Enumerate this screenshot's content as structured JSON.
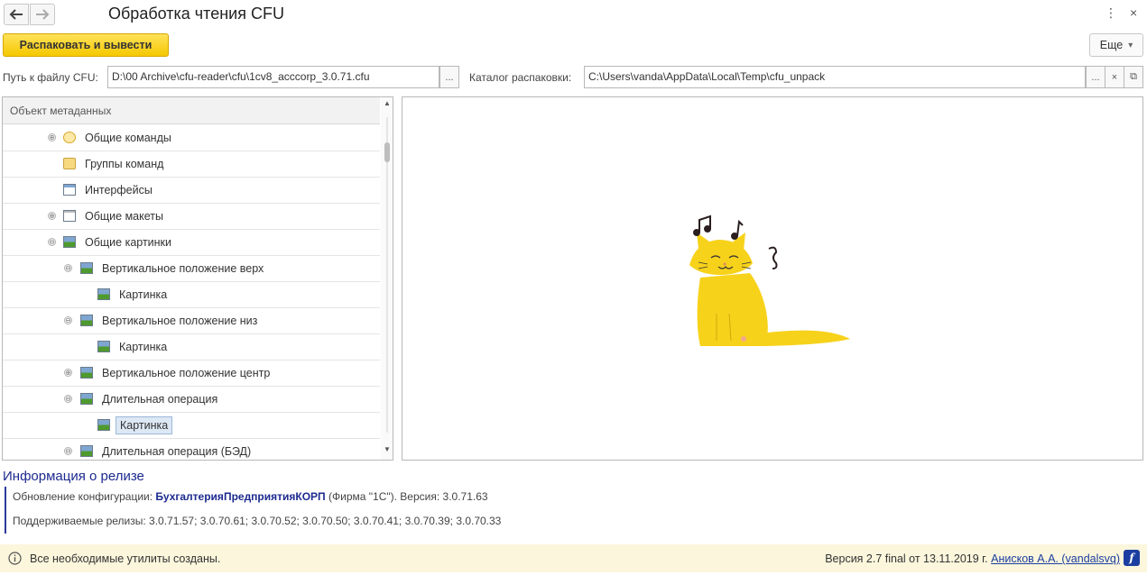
{
  "window": {
    "title": "Обработка чтения CFU",
    "back_icon": "arrow-left-icon",
    "forward_icon": "arrow-right-icon",
    "menu_glyph": "⋮",
    "close_glyph": "×"
  },
  "toolbar": {
    "unpack_label": "Распаковать и вывести",
    "more_label": "Еще",
    "more_arrow": "▾"
  },
  "fields": {
    "cfu_path_label": "Путь к файлу CFU:",
    "cfu_path_value": "D:\\00 Archive\\cfu-reader\\cfu\\1cv8_acccorp_3.0.71.cfu",
    "unpack_dir_label": "Каталог распаковки:",
    "unpack_dir_value": "C:\\Users\\vanda\\AppData\\Local\\Temp\\cfu_unpack",
    "browse_glyph": "...",
    "clear_glyph": "×",
    "open_glyph": "⧉"
  },
  "tree": {
    "header": "Объект метаданных",
    "items": [
      {
        "label": "Общие команды",
        "expander": "⊕",
        "icon": "command-icon"
      },
      {
        "label": "Группы команд",
        "expander": "",
        "icon": "folder-icon"
      },
      {
        "label": "Интерфейсы",
        "expander": "",
        "icon": "interface-icon"
      },
      {
        "label": "Общие макеты",
        "expander": "⊕",
        "icon": "layout-icon"
      },
      {
        "label": "Общие картинки",
        "expander": "⊖",
        "icon": "picture-icon"
      },
      {
        "label": "Вертикальное положение верх",
        "expander": "⊖",
        "icon": "picture-icon"
      },
      {
        "label": "Картинка",
        "expander": "",
        "icon": "picture-icon"
      },
      {
        "label": "Вертикальное положение низ",
        "expander": "⊖",
        "icon": "picture-icon"
      },
      {
        "label": "Картинка",
        "expander": "",
        "icon": "picture-icon"
      },
      {
        "label": "Вертикальное положение центр",
        "expander": "⊕",
        "icon": "picture-icon"
      },
      {
        "label": "Длительная операция",
        "expander": "⊖",
        "icon": "picture-icon"
      },
      {
        "label": "Картинка",
        "expander": "",
        "icon": "picture-icon",
        "selected": true
      },
      {
        "label": "Длительная операция (БЭД)",
        "expander": "⊖",
        "icon": "picture-icon"
      }
    ]
  },
  "preview": {
    "image": "singing-yellow-cat-icon",
    "colors": {
      "cat": "#f7d21b",
      "notes": "#2b1e1e"
    }
  },
  "release": {
    "title": "Информация о релизе",
    "update_prefix": "Обновление конфигурации: ",
    "config_name": "БухгалтерияПредприятияКОРП",
    "update_suffix": " (Фирма \"1С\"). Версия: 3.0.71.63",
    "supported": "Поддерживаемые релизы: 3.0.71.57; 3.0.70.61; 3.0.70.52; 3.0.70.50; 3.0.70.41; 3.0.70.39; 3.0.70.33"
  },
  "status": {
    "message": "Все необходимые утилиты созданы.",
    "version_text": "Версия 2.7 final от 13.11.2019 г. ",
    "author_link": "Анисков А.А. (vandalsvq)",
    "info_glyph": "f",
    "icon": "info-icon",
    "colors": {
      "bar": "#fbf6dc",
      "accent": "#f5c800",
      "link": "#1c3ea0"
    }
  }
}
